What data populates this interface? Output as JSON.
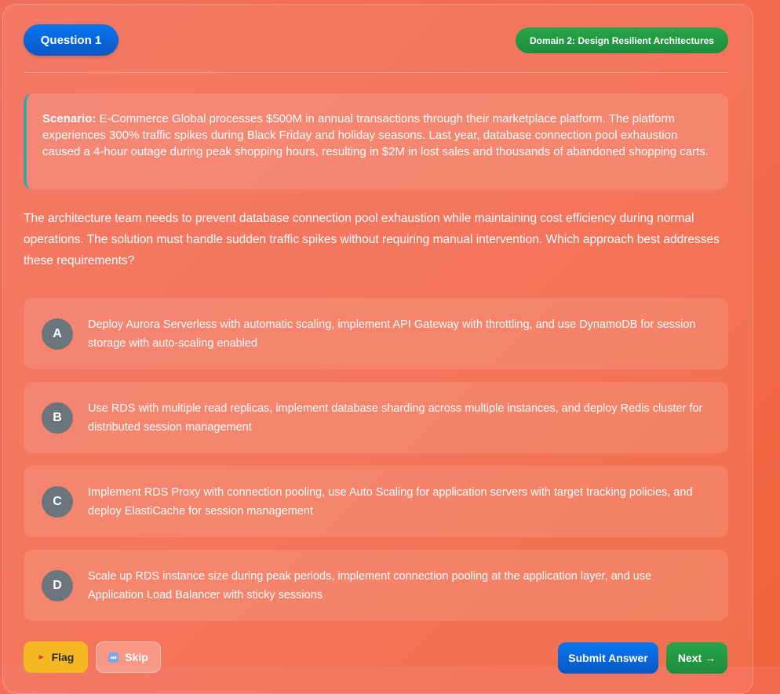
{
  "header": {
    "question_label": "Question 1",
    "domain_label": "Domain 2: Design Resilient Architectures"
  },
  "scenario": {
    "label": "Scenario:",
    "text": " E-Commerce Global processes $500M in annual transactions through their marketplace platform. The platform experiences 300% traffic spikes during Black Friday and holiday seasons. Last year, database connection pool exhaustion caused a 4-hour outage during peak shopping hours, resulting in $2M in lost sales and thousands of abandoned shopping carts."
  },
  "question_text": "The architecture team needs to prevent database connection pool exhaustion while maintaining cost efficiency during normal operations. The solution must handle sudden traffic spikes without requiring manual intervention. Which approach best addresses these requirements?",
  "options": [
    {
      "letter": "A",
      "text": "Deploy Aurora Serverless with automatic scaling, implement API Gateway with throttling, and use DynamoDB for session storage with auto-scaling enabled"
    },
    {
      "letter": "B",
      "text": "Use RDS with multiple read replicas, implement database sharding across multiple instances, and deploy Redis cluster for distributed session management"
    },
    {
      "letter": "C",
      "text": "Implement RDS Proxy with connection pooling, use Auto Scaling for application servers with target tracking policies, and deploy ElastiCache for session management"
    },
    {
      "letter": "D",
      "text": "Scale up RDS instance size during peak periods, implement connection pooling at the application layer, and use Application Load Balancer with sticky sessions"
    }
  ],
  "actions": {
    "flag_label": "Flag",
    "skip_label": "Skip",
    "submit_label": "Submit Answer",
    "next_label": "Next",
    "flag_icon": "flag-icon",
    "skip_icon": "skip-icon",
    "next_icon": "arrow-right-icon"
  },
  "colors": {
    "background": "#f26e58",
    "question_badge": "#0a76f0",
    "domain_badge": "#27a54a",
    "scenario_border": "#3fa3a6",
    "option_letter": "#6c747c",
    "flag_button": "#f5b820",
    "next_button": "#27a54a"
  }
}
